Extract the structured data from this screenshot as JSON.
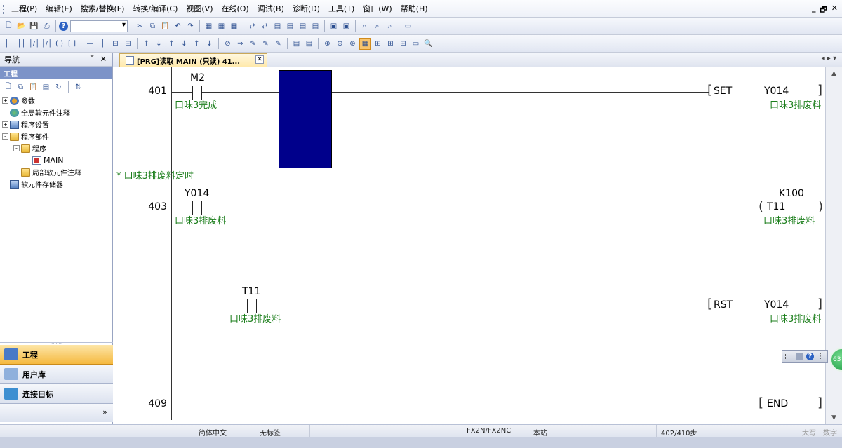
{
  "menubar": {
    "items": [
      "工程(P)",
      "编辑(E)",
      "搜索/替换(F)",
      "转换/编译(C)",
      "视图(V)",
      "在线(O)",
      "调试(B)",
      "诊断(D)",
      "工具(T)",
      "窗口(W)",
      "帮助(H)"
    ],
    "window_controls": [
      "_",
      "🗗",
      "✕"
    ]
  },
  "toolbar": {
    "help_icon": "?"
  },
  "navigation": {
    "title": "导航",
    "pin": "ꟸ",
    "close": "✕",
    "section": "工程",
    "tree": [
      {
        "label": "参数",
        "level": 0,
        "exp": "+",
        "icon": "gear"
      },
      {
        "label": "全局软元件注释",
        "level": 0,
        "exp": "",
        "icon": "globe"
      },
      {
        "label": "程序设置",
        "level": 0,
        "exp": "+",
        "icon": "dev"
      },
      {
        "label": "程序部件",
        "level": 0,
        "exp": "-",
        "icon": "folder"
      },
      {
        "label": "程序",
        "level": 1,
        "exp": "-",
        "icon": "folder"
      },
      {
        "label": "MAIN",
        "level": 2,
        "exp": "",
        "icon": "prog"
      },
      {
        "label": "局部软元件注释",
        "level": 1,
        "exp": "",
        "icon": "folder"
      },
      {
        "label": "软元件存储器",
        "level": 0,
        "exp": "",
        "icon": "dev"
      }
    ],
    "bottom_tabs": [
      {
        "label": "工程",
        "active": true,
        "color": "#4a7ac7"
      },
      {
        "label": "用户库",
        "active": false,
        "color": "#8fb0dc"
      },
      {
        "label": "连接目标",
        "active": false,
        "color": "#3d8fd1"
      }
    ],
    "more": "»"
  },
  "editor": {
    "tab_label": "[PRG]读取 MAIN (只读) 41...",
    "tab_close": "✕",
    "tab_nav": "◂ ▸ ▾",
    "rungs": {
      "r401": {
        "step": "401",
        "contact": "M2",
        "contact_comment": "口味3完成",
        "instr": "SET",
        "operand": "Y014",
        "operand_comment": "口味3排废料"
      },
      "rung_comment": "* 口味3排废料定时",
      "r403": {
        "step": "403",
        "contact": "Y014",
        "contact_comment": "口味3排废料",
        "timer_const": "K100",
        "coil": "T11",
        "coil_comment": "口味3排废料"
      },
      "r407": {
        "contact": "T11",
        "contact_comment": "口味3排废料",
        "instr": "RST",
        "operand": "Y014",
        "operand_comment": "口味3排废料"
      },
      "r409": {
        "step": "409",
        "instr": "END"
      }
    }
  },
  "statusbar": {
    "language": "简体中文",
    "label": "无标签",
    "plc": "FX2N/FX2NC",
    "station": "本站",
    "steps": "402/410步",
    "caps": "大写",
    "num": "数字"
  },
  "float_widget": {
    "help": "?",
    "badge": "63"
  }
}
